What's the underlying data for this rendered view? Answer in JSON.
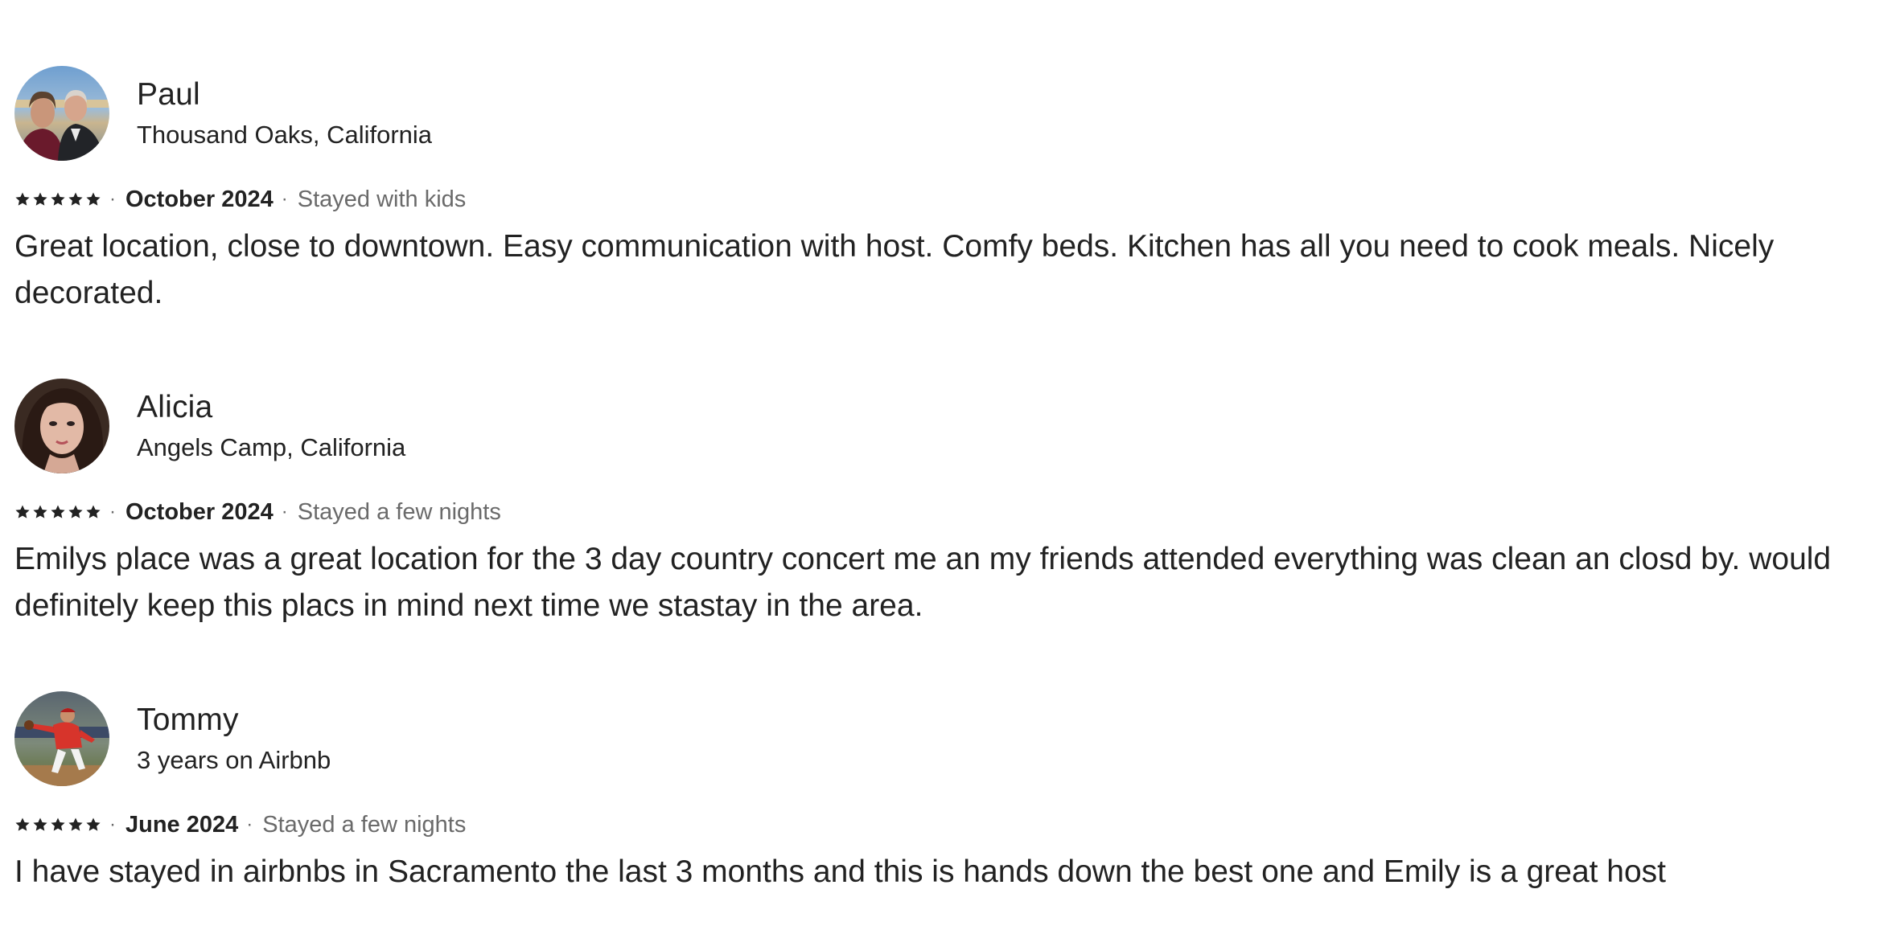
{
  "reviews": [
    {
      "name": "Paul",
      "subtitle": "Thousand Oaks, California",
      "rating": 5,
      "date": "October 2024",
      "stay_type": "Stayed with kids",
      "separator": "·",
      "text": "Great location, close to downtown. Easy communication with host. Comfy beds. Kitchen has all you need to cook meals. Nicely decorated.",
      "avatar_icon": "avatar-couple-photo"
    },
    {
      "name": "Alicia",
      "subtitle": "Angels Camp, California",
      "rating": 5,
      "date": "October 2024",
      "stay_type": "Stayed a few nights",
      "separator": "·",
      "text": "Emilys place was a great location for the 3 day country concert me an my friends attended everything was clean an closd by. would definitely keep this placs in mind next time we stastay in the area.",
      "avatar_icon": "avatar-woman-photo"
    },
    {
      "name": "Tommy",
      "subtitle": "3 years on Airbnb",
      "rating": 5,
      "date": "June 2024",
      "stay_type": "Stayed a few nights",
      "separator": "·",
      "text": "I have stayed in airbnbs in Sacramento the last 3 months and this is hands down the best one and Emily is a great host",
      "avatar_icon": "avatar-baseball-photo"
    }
  ],
  "colors": {
    "text_primary": "#222222",
    "text_secondary": "#6a6a6a",
    "background": "#ffffff"
  }
}
